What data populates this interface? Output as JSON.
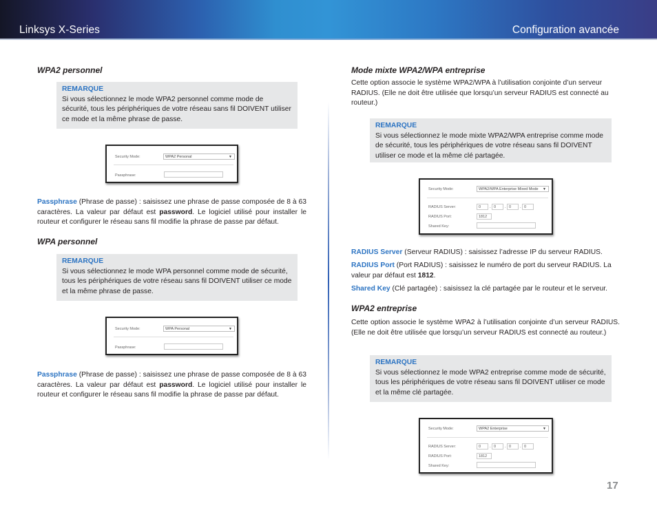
{
  "header": {
    "left_title": "Linksys X-Series",
    "right_title": "Configuration avancée"
  },
  "left_column": {
    "wpa2_personal": {
      "heading": "WPA2 personnel",
      "note": {
        "label": "REMARQUE",
        "text": "Si vous sélectionnez le mode WPA2 personnel comme mode de sécurité, tous les périphériques de votre réseau sans fil DOIVENT utiliser ce mode et la même phrase de passe."
      },
      "screenshot": {
        "security_mode_label": "Security Mode:",
        "security_mode_value": "WPA2 Personal",
        "passphrase_label": "Passphrase:",
        "passphrase_value": ""
      },
      "description": {
        "term": "Passphrase",
        "text_before_bold": "  (Phrase de passe) : saisissez une phrase de passe composée de 8 à 63 caractères. La valeur par défaut est ",
        "bold": "password",
        "text_after_bold": ". Le logiciel utilisé pour installer le routeur et configurer le réseau sans fil modifie la phrase de passe par défaut."
      }
    },
    "wpa_personal": {
      "heading": "WPA personnel",
      "note": {
        "label": "REMARQUE",
        "text": "Si vous sélectionnez le mode WPA personnel comme mode de sécurité, tous les périphériques de votre réseau sans fil DOIVENT utiliser ce mode et la même phrase de passe."
      },
      "screenshot": {
        "security_mode_label": "Security Mode:",
        "security_mode_value": "WPA Personal",
        "passphrase_label": "Passphrase:",
        "passphrase_value": ""
      },
      "description": {
        "term": "Passphrase",
        "text_before_bold": "  (Phrase de passe) : saisissez une phrase de passe composée de 8 à 63 caractères. La valeur par défaut est ",
        "bold": "password",
        "text_after_bold": ". Le logiciel utilisé pour installer le routeur et configurer le réseau sans fil modifie la phrase de passe par défaut."
      }
    }
  },
  "right_column": {
    "mixed_enterprise": {
      "heading": "Mode mixte WPA2/WPA entreprise",
      "intro": "Cette option associe le système WPA2/WPA à l’utilisation conjointe d’un serveur RADIUS. (Elle ne doit être utilisée que lorsqu’un serveur RADIUS est connecté au routeur.)",
      "note": {
        "label": "REMARQUE",
        "text": "Si vous sélectionnez le mode mixte WPA2/WPA entreprise comme mode de sécurité, tous les périphériques de votre réseau sans fil DOIVENT utiliser ce mode et la même clé partagée."
      },
      "screenshot": {
        "security_mode_label": "Security Mode:",
        "security_mode_value": "WPA2/WPA Enterprise Mixed Mode",
        "radius_server_label": "RADIUS Server:",
        "radius_server_octets": [
          "0",
          "0",
          "0",
          "0"
        ],
        "radius_port_label": "RADIUS Port:",
        "radius_port_value": "1812",
        "shared_key_label": "Shared Key:",
        "shared_key_value": ""
      },
      "definitions": [
        {
          "term": "RADIUS Server",
          "text": "  (Serveur RADIUS) : saisissez l’adresse IP du serveur RADIUS."
        },
        {
          "term": "RADIUS Port",
          "text": " (Port RADIUS) : saisissez le numéro de port du serveur RADIUS. La valeur par défaut est ",
          "bold": "1812",
          "text_after": "."
        },
        {
          "term": "Shared Key",
          "text": " (Clé partagée) : saisissez la clé partagée par le routeur et le serveur."
        }
      ]
    },
    "wpa2_enterprise": {
      "heading": "WPA2 entreprise",
      "intro": "Cette option associe le système WPA2 à l’utilisation conjointe d’un serveur RADIUS. (Elle ne doit être utilisée que lorsqu’un serveur RADIUS est connecté au routeur.)",
      "note": {
        "label": "REMARQUE",
        "text": "Si vous sélectionnez le mode WPA2 entreprise comme mode de sécurité, tous les périphériques de votre réseau sans fil DOIVENT utiliser ce mode et la même clé partagée."
      },
      "screenshot": {
        "security_mode_label": "Security Mode:",
        "security_mode_value": "WPA2 Enterprise",
        "radius_server_label": "RADIUS Server:",
        "radius_server_octets": [
          "0",
          "0",
          "0",
          "0"
        ],
        "radius_port_label": "RADIUS Port:",
        "radius_port_value": "1812",
        "shared_key_label": "Shared Key:",
        "shared_key_value": ""
      }
    }
  },
  "footer": {
    "page_number": "17"
  },
  "colors": {
    "accent_blue": "#2b73c2",
    "note_background": "#e6e7e8",
    "page_number_gray": "#8a8c8e"
  }
}
